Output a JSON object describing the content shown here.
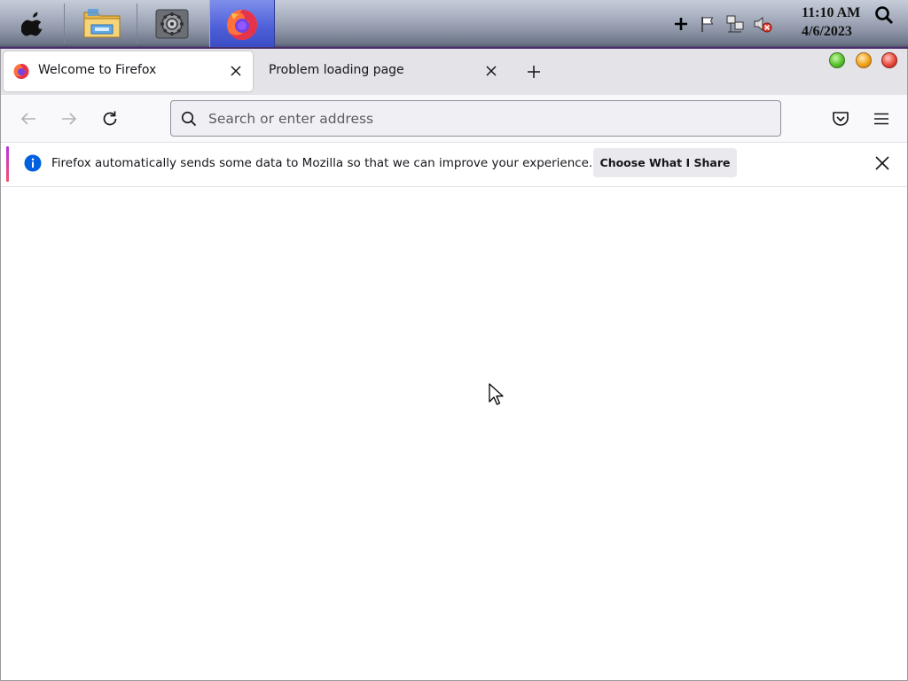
{
  "taskbar": {
    "apps": [
      {
        "name": "apple-menu",
        "icon": "apple-icon"
      },
      {
        "name": "file-explorer",
        "icon": "folder-icon"
      },
      {
        "name": "system-settings",
        "icon": "gear-icon"
      },
      {
        "name": "firefox",
        "icon": "firefox-icon",
        "active": true
      }
    ],
    "tray_icons": [
      "plus-icon",
      "flag-icon",
      "network-icon",
      "volume-muted-icon"
    ],
    "clock": {
      "time": "11:10 AM",
      "date": "4/6/2023"
    }
  },
  "browser": {
    "tabs": [
      {
        "label": "Welcome to Firefox",
        "active": true
      },
      {
        "label": "Problem loading page",
        "active": false
      }
    ],
    "urlbar": {
      "placeholder": "Search or enter address",
      "value": ""
    },
    "notification": {
      "message": "Firefox automatically sends some data to Mozilla so that we can improve your experience.",
      "button_label": "Choose What I Share"
    }
  },
  "colors": {
    "accent_blue": "#0060df",
    "taskbar_active": "#4d5fd8",
    "tab_strip": "#e3e3e8"
  }
}
